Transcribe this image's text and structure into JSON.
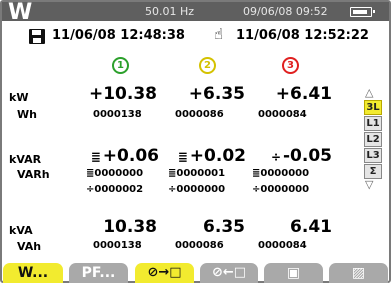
{
  "status": {
    "mode": "W",
    "frequency": "50.01 Hz",
    "datetime": "09/06/08 09:52",
    "battery_icon": "battery-icon"
  },
  "record": {
    "start": "11/06/08 12:48:38",
    "end": "11/06/08 12:52:22"
  },
  "phases": [
    {
      "label": "1",
      "color": "#2ca02c"
    },
    {
      "label": "2",
      "color": "#d4c200"
    },
    {
      "label": "3",
      "color": "#e02020"
    }
  ],
  "rows": {
    "kw": {
      "label": "kW",
      "sub": "Wh",
      "values": [
        "+10.38",
        "+6.35",
        "+6.41"
      ],
      "energy": [
        "0000138",
        "0000086",
        "0000084"
      ]
    },
    "kvar": {
      "label": "kVAR",
      "sub": "VARh",
      "values": [
        "+0.06",
        "+0.02",
        "-0.05"
      ],
      "symbols": [
        "≣",
        "≣",
        "÷"
      ],
      "energy_ind": [
        "0000000",
        "0000001",
        "0000000"
      ],
      "energy_cap": [
        "0000002",
        "0000000",
        "0000000"
      ],
      "ind_symbol": "≣",
      "cap_symbol": "÷"
    },
    "kva": {
      "label": "kVA",
      "sub": "VAh",
      "values": [
        "10.38",
        "6.35",
        "6.41"
      ],
      "energy": [
        "0000138",
        "0000086",
        "0000084"
      ]
    }
  },
  "selector": {
    "up": "△",
    "down": "▽",
    "items": [
      "3L",
      "L1",
      "L2",
      "L3",
      "Σ"
    ],
    "active": "3L"
  },
  "softkeys": {
    "w": "W...",
    "pf": "PF...",
    "energy_consumed": "⊘→□",
    "energy_generated": "⊘←□",
    "save": "▣",
    "trash": "▨"
  }
}
